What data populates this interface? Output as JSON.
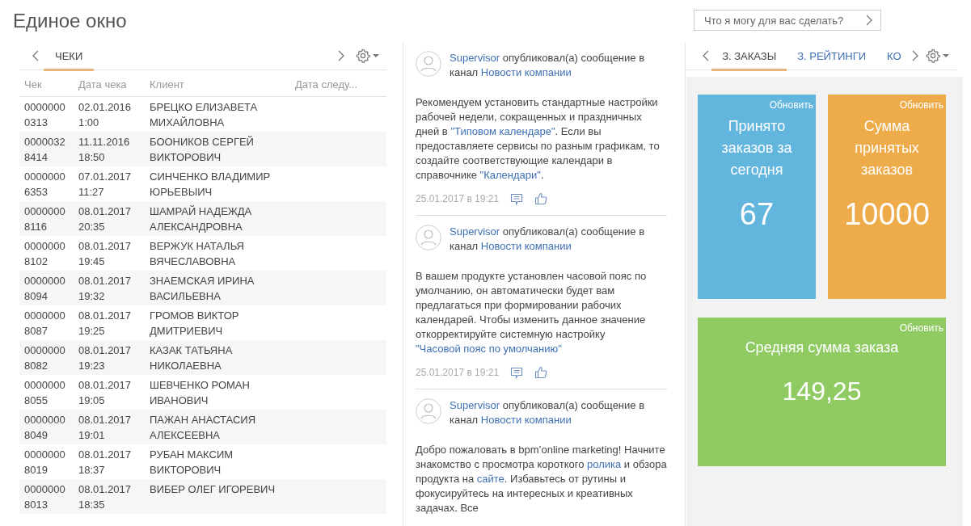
{
  "header": {
    "title": "Единое окно"
  },
  "search": {
    "placeholder": "Что я могу для вас сделать?"
  },
  "left_panel": {
    "tabs": [
      {
        "label": "ЧЕКИ",
        "selected": true
      }
    ],
    "table": {
      "columns": [
        "Чек",
        "Дата чека",
        "Клиент",
        "Дата следу..."
      ],
      "rows": [
        {
          "cells": [
            "00000000313",
            "02.01.2016 1:00",
            "БРЕЦКО ЕЛИЗАВЕТА МИХАЙЛОВНА"
          ]
        },
        {
          "cells": [
            "00000328414",
            "11.11.2016 18:50",
            "БООНИКОВ СЕРГЕЙ ВИКТОРОВИЧ"
          ]
        },
        {
          "cells": [
            "00000006353",
            "07.01.2017 11:27",
            "СИНЧЕНКО ВЛАДИМИР ЮРЬЕВЫИЧ"
          ]
        },
        {
          "cells": [
            "00000008116",
            "08.01.2017 20:35",
            "ШАМРАЙ НАДЕЖДА АЛЕКСАНДРОВНА"
          ]
        },
        {
          "cells": [
            "00000008102",
            "08.01.2017 19:45",
            "ВЕРЖУК НАТАЛЬЯ ВЯЧЕСЛАВОВНА"
          ]
        },
        {
          "cells": [
            "00000008094",
            "08.01.2017 19:32",
            "ЗНАЕМСКАЯ ИРИНА ВАСИЛЬЕВНА"
          ]
        },
        {
          "cells": [
            "00000008087",
            "08.01.2017 19:25",
            "ГРОМОВ ВИКТОР ДМИТРИЕВИЧ"
          ]
        },
        {
          "cells": [
            "00000008082",
            "08.01.2017 19:23",
            "КАЗАК ТАТЬЯНА НИКОЛАЕВНА"
          ]
        },
        {
          "cells": [
            "00000008055",
            "08.01.2017 19:05",
            "ШЕВЧЕНКО РОМАН ИВАНОВИЧ"
          ]
        },
        {
          "cells": [
            "00000008049",
            "08.01.2017 19:01",
            "ПАЖАН АНАСТАСИЯ АЛЕКСЕЕВНА"
          ]
        },
        {
          "cells": [
            "00000008019",
            "08.01.2017 18:37",
            "РУБАН МАКСИМ ВИКТОРОВИЧ"
          ]
        },
        {
          "cells": [
            "00000008013",
            "08.01.2017 18:35",
            "ВИБЕР ОЛЕГ ИГОРЕВИЧ"
          ]
        }
      ]
    }
  },
  "feed": {
    "posts": [
      {
        "author": "Supervisor",
        "action": "опубликовал(а) сообщение в канал",
        "channel": "Новости компании",
        "body": [
          {
            "kind": "text",
            "text": "Рекомендуем установить стандартные настройки рабочей недели, сокращенных и праздничных дней в "
          },
          {
            "kind": "link",
            "text": "\"Типовом календаре\""
          },
          {
            "kind": "text",
            "text": ". Если вы предоставляете сервисы по разным графикам, то создайте соответствующие календари в справочнике "
          },
          {
            "kind": "link",
            "text": "\"Календари\""
          },
          {
            "kind": "text",
            "text": "."
          }
        ],
        "time": "25.01.2017 в 19:21"
      },
      {
        "author": "Supervisor",
        "action": "опубликовал(а) сообщение в канал",
        "channel": "Новости компании",
        "body": [
          {
            "kind": "text",
            "text": "В вашем продукте установлен часовой пояс по умолчанию, он автоматически будет вам предлагаться при формировании рабочих календарей. Чтобы изменить данное значение откорректируйте системную настройку "
          },
          {
            "kind": "link",
            "text": "\"Часовой пояс по умолчанию\""
          }
        ],
        "time": "25.01.2017 в 19:21"
      },
      {
        "author": "Supervisor",
        "action": "опубликовал(а) сообщение в канал",
        "channel": "Новости компании",
        "body": [
          {
            "kind": "text",
            "text": "Добро пожаловать в bpm’online marketing! Начните знакомство с просмотра короткого "
          },
          {
            "kind": "link",
            "text": "ролика"
          },
          {
            "kind": "text",
            "text": " и обзора продукта на "
          },
          {
            "kind": "link",
            "text": "сайте"
          },
          {
            "kind": "text",
            "text": ". Избавьтесь от рутины и фокусируйтесь на интересных и креативных задачах. Все"
          }
        ]
      }
    ]
  },
  "right_panel": {
    "tabs": [
      {
        "label": "З. ЗАКАЗЫ",
        "selected": true
      },
      {
        "label": "З. РЕЙТИНГИ",
        "selected": false
      },
      {
        "label": "КО",
        "selected": false
      }
    ],
    "tiles": [
      {
        "refresh": "Обновить",
        "title": "Принято заказов за сегодня",
        "value": "67",
        "color": "#62b5dd"
      },
      {
        "refresh": "Обновить",
        "title": "Сумма принятых заказов",
        "value": "10000",
        "color": "#edab4a"
      },
      {
        "refresh": "Обновить",
        "title": "Средняя сумма заказа",
        "value": "149,25",
        "color": "#8fcb62"
      }
    ]
  }
}
